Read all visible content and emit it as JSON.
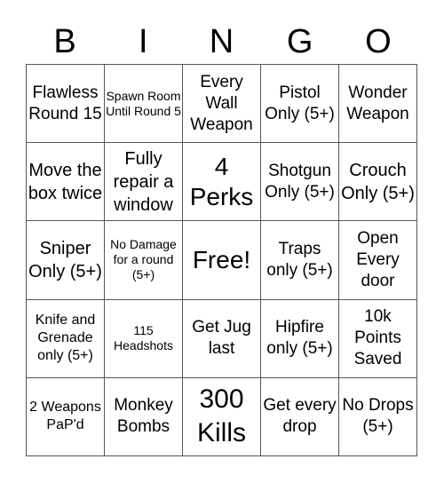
{
  "header": {
    "letters": [
      "B",
      "I",
      "N",
      "G",
      "O"
    ]
  },
  "cells": [
    [
      "Flawless Round 15",
      "Spawn Room Until Round 5",
      "Every Wall Weapon",
      "Pistol Only (5+)",
      "Wonder Weapon"
    ],
    [
      "Move the box twice",
      "Fully repair a window",
      "4 Perks",
      "Shotgun Only (5+)",
      "Crouch Only (5+)"
    ],
    [
      "Sniper Only (5+)",
      "No Damage for a round (5+)",
      "Free!",
      "Traps only (5+)",
      "Open Every door"
    ],
    [
      "Knife and Grenade only (5+)",
      "115 Headshots",
      "Get Jug last",
      "Hipfire only (5+)",
      "10k Points Saved"
    ],
    [
      "2 Weapons PaP'd",
      "Monkey Bombs",
      "300 Kills",
      "Get every drop",
      "No Drops (5+)"
    ]
  ],
  "colors": {
    "grid_line": "#555555",
    "text": "#000000",
    "background": "#ffffff"
  }
}
